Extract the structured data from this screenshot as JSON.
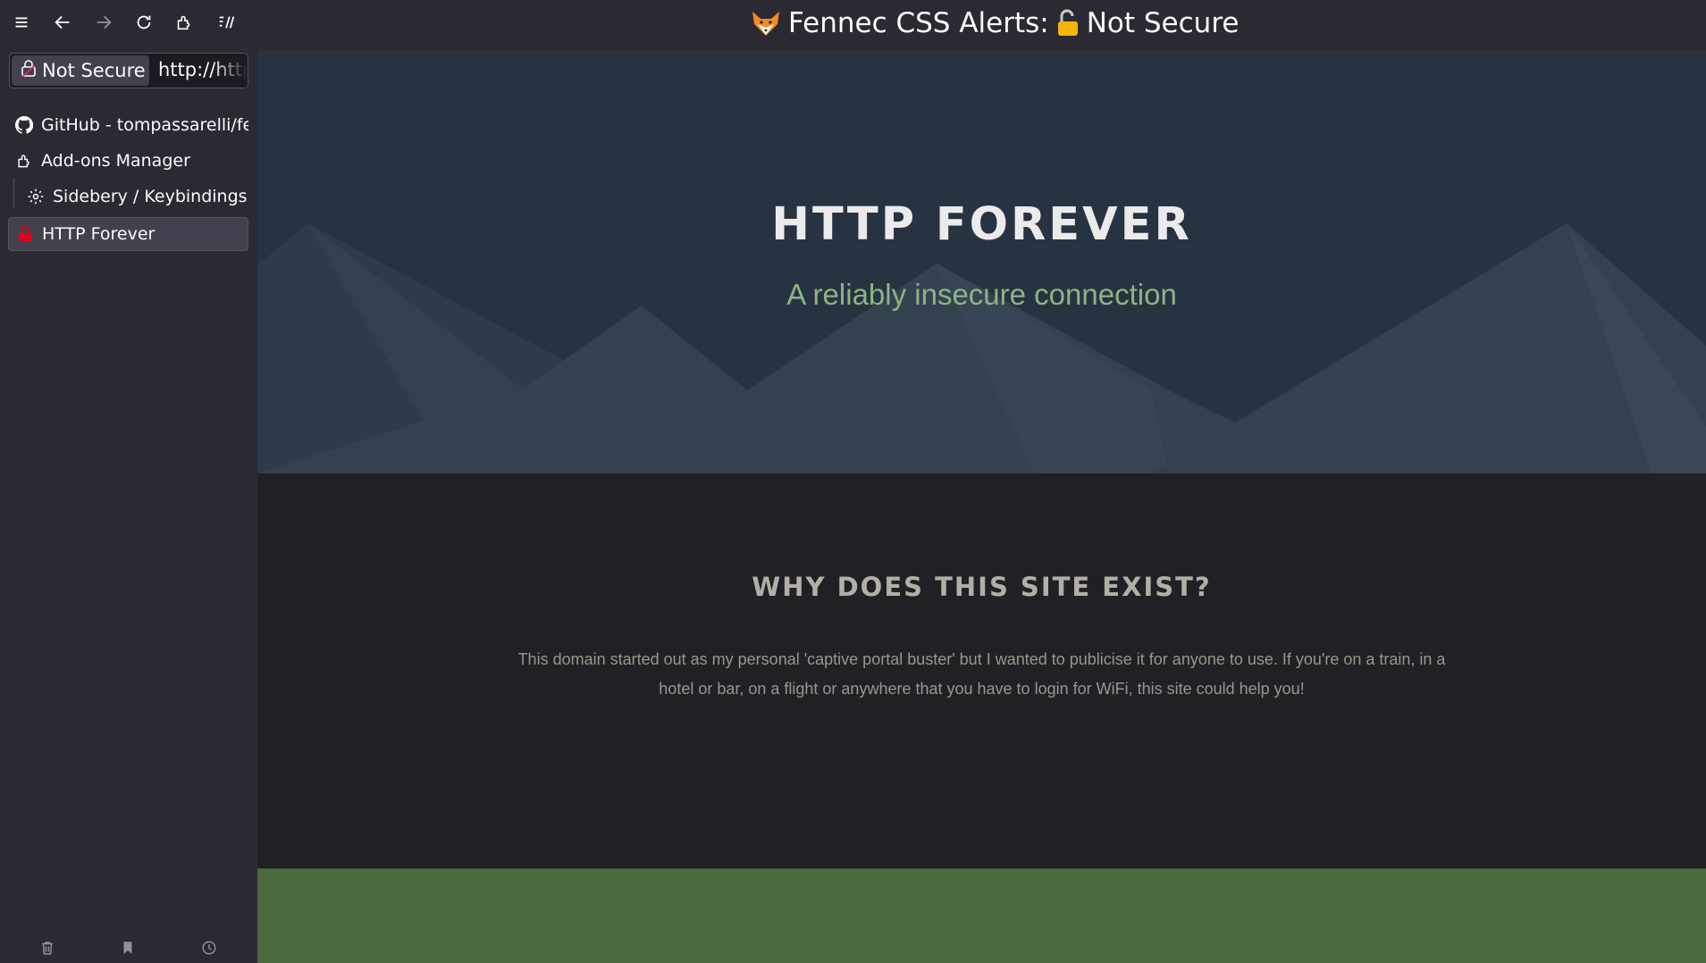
{
  "window": {
    "title_prefix": "Fennec CSS Alerts:",
    "title_suffix": "Not Secure"
  },
  "toolbar": {
    "buttons": [
      "menu-icon",
      "back-icon",
      "forward-icon",
      "reload-icon",
      "extensions-icon",
      "sidebery-icon"
    ]
  },
  "urlbar": {
    "identity_label": "Not Secure",
    "url": "http://httpforever.com/"
  },
  "tabs": [
    {
      "label": "GitHub - tompassarelli/fennec",
      "icon": "github-icon"
    },
    {
      "label": "Add-ons Manager",
      "icon": "puzzle-icon"
    },
    {
      "label": "Sidebery / Keybindings",
      "icon": "gear-icon"
    },
    {
      "label": "HTTP Forever",
      "icon": "red-lock-icon"
    }
  ],
  "sidebar_bottom": [
    "trash-icon",
    "bookmark-icon",
    "history-icon"
  ],
  "page": {
    "hero_title": "HTTP FOREVER",
    "hero_subtitle": "A reliably insecure connection",
    "why_title": "WHY DOES THIS SITE EXIST?",
    "why_text": "This domain started out as my personal 'captive portal buster' but I wanted to publicise it for anyone to use. If you're on a train, in a hotel or bar, on a flight or anywhere that you have to login for WiFi, this site could help you!"
  },
  "colors": {
    "chrome": "#2b2a33",
    "hero_bg": "#283341",
    "hero_subtitle": "#8bb483",
    "section_bg": "#202124",
    "footer_green": "#4a6a3e"
  }
}
